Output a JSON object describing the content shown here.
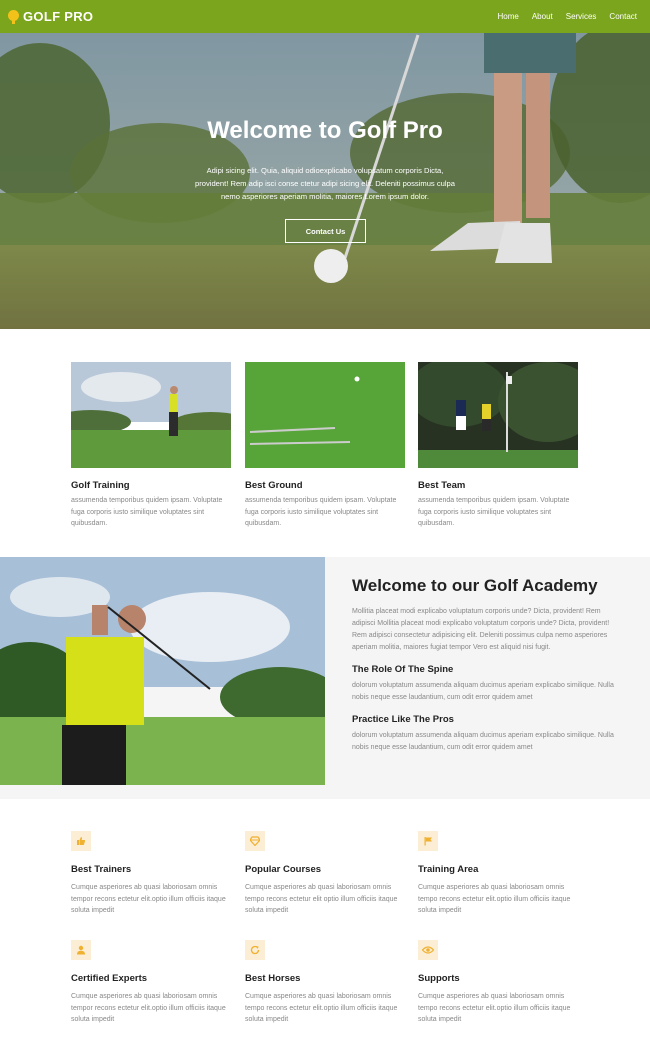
{
  "nav": {
    "brand": "GOLF PRO",
    "links": [
      "Home",
      "About",
      "Services",
      "Contact"
    ]
  },
  "hero": {
    "title": "Welcome to Golf Pro",
    "text": "Adipi sicing elit. Quia, aliquid odioexplicabo volupsatum corporis Dicta, provident! Rem adip isci conse ctetur adipi sicing elit. Deleniti possimus culpa nemo asperiores aperiam molitia, maiores Lorem ipsum dolor.",
    "button": "Contact Us"
  },
  "features": [
    {
      "title": "Golf Training",
      "text": "assumenda temporibus quidem ipsam. Voluptate fuga corporis iusto similique voluptates sint quibusdam."
    },
    {
      "title": "Best Ground",
      "text": "assumenda temporibus quidem ipsam. Voluptate fuga corporis iusto similique voluptates sint quibusdam."
    },
    {
      "title": "Best Team",
      "text": "assumenda temporibus quidem ipsam. Voluptate fuga corporis iusto similique voluptates sint quibusdam."
    }
  ],
  "academy": {
    "title": "Welcome to our Golf Academy",
    "text": "Mollitia placeat modi explicabo voluptatum corporis unde? Dicta, provident! Rem adipisci Mollitia placeat modi explicabo voluptatum corporis unde? Dicta, provident! Rem adipisci consectetur adipisicing elit. Deleniti possimus culpa nemo asperiores aperiam molitia, maiores fugiat tempor Vero est aliquid nisi fugit.",
    "sections": [
      {
        "title": "The Role Of The Spine",
        "text": "dolorum voluptatum assumenda aliquam ducimus aperiam explicabo similique. Nulla nobis neque esse laudantium, cum odit error quidem amet"
      },
      {
        "title": "Practice Like The Pros",
        "text": "dolorum voluptatum assumenda aliquam ducimus aperiam explicabo similique. Nulla nobis neque esse laudantium, cum odit error quidem amet"
      }
    ]
  },
  "services": [
    {
      "icon": "thumbs-up-icon",
      "title": "Best Trainers",
      "text": "Cumque asperiores ab quasi laboriosam omnis tempor recons ectetur elit.optio illum officiis itaque soluta impedit"
    },
    {
      "icon": "diamond-icon",
      "title": "Popular Courses",
      "text": "Cumque asperiores ab quasi laboriosam omnis tempo recons ectetur elit optio illum officiis itaque soluta impedit"
    },
    {
      "icon": "flag-icon",
      "title": "Training Area",
      "text": "Cumque asperiores ab quasi laboriosam omnis tempo recons ectetur elit.optio illum officiis itaque soluta impedit"
    },
    {
      "icon": "user-icon",
      "title": "Certified Experts",
      "text": "Cumque asperiores ab quasi laboriosam omnis tempor recons ectetur elit.optio illum officiis itaque soluta impedit"
    },
    {
      "icon": "refresh-icon",
      "title": "Best Horses",
      "text": "Cumque asperiores ab quasi laboriosam omnis tempo recons ectetur elit.optio illum officiis itaque soluta impedit"
    },
    {
      "icon": "eye-icon",
      "title": "Supports",
      "text": "Cumque asperiores ab quasi laboriosam omnis tempo recons ectetur elit.optio illum officiis itaque soluta impedit"
    }
  ],
  "colors": {
    "brand_green": "#7ba51c",
    "accent_yellow": "#f2c21a",
    "icon_bg": "#fbeed4"
  }
}
